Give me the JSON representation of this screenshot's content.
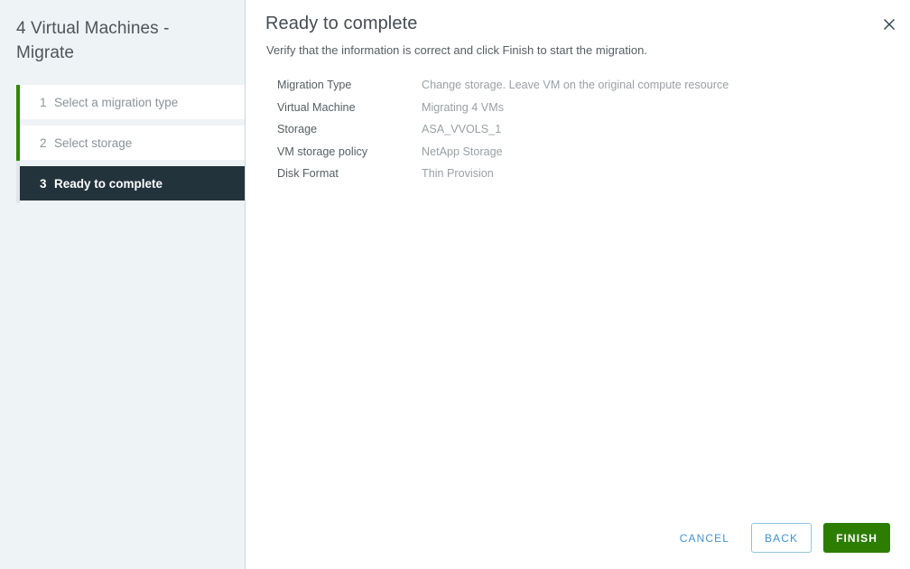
{
  "wizard": {
    "title": "4 Virtual Machines - Migrate",
    "close_icon": "close-icon"
  },
  "steps": [
    {
      "number": "1",
      "label": "Select a migration type",
      "state": "complete"
    },
    {
      "number": "2",
      "label": "Select storage",
      "state": "complete"
    },
    {
      "number": "3",
      "label": "Ready to complete",
      "state": "active"
    }
  ],
  "page": {
    "title": "Ready to complete",
    "subtitle": "Verify that the information is correct and click Finish to start the migration."
  },
  "details": [
    {
      "label": "Migration Type",
      "value": "Change storage. Leave VM on the original compute resource"
    },
    {
      "label": "Virtual Machine",
      "value": "Migrating 4 VMs"
    },
    {
      "label": "Storage",
      "value": "ASA_VVOLS_1"
    },
    {
      "label": "VM storage policy",
      "value": "NetApp Storage"
    },
    {
      "label": "Disk Format",
      "value": "Thin Provision"
    }
  ],
  "footer": {
    "cancel_label": "CANCEL",
    "back_label": "BACK",
    "finish_label": "FINISH"
  },
  "colors": {
    "sidebar_bg": "#eef3f6",
    "active_step_bg": "#22333c",
    "progress_rail": "#318700",
    "rail_track": "#dfe5e9",
    "primary_button": "#2d7d00",
    "link_blue": "#4294d0",
    "outline_border": "#8fc4e0"
  }
}
